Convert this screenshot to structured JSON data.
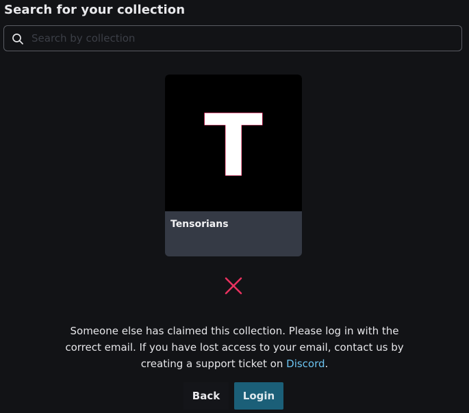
{
  "header": {
    "title": "Search for your collection"
  },
  "search": {
    "placeholder": "Search by collection",
    "value": ""
  },
  "collection_card": {
    "letter": "T",
    "name": "Tensorians"
  },
  "status": {
    "icon": "x-icon",
    "color": "#e8325f"
  },
  "message": {
    "text_before_link": "Someone else has claimed this collection. Please log in with the correct email. If you have lost access to your email, contact us by creating a support ticket on ",
    "link_text": "Discord",
    "text_after_link": "."
  },
  "actions": {
    "back_label": "Back",
    "login_label": "Login"
  },
  "colors": {
    "background": "#121316",
    "link": "#6bc3f0",
    "login_button": "#1b5f78",
    "card_footer": "#353a45"
  }
}
